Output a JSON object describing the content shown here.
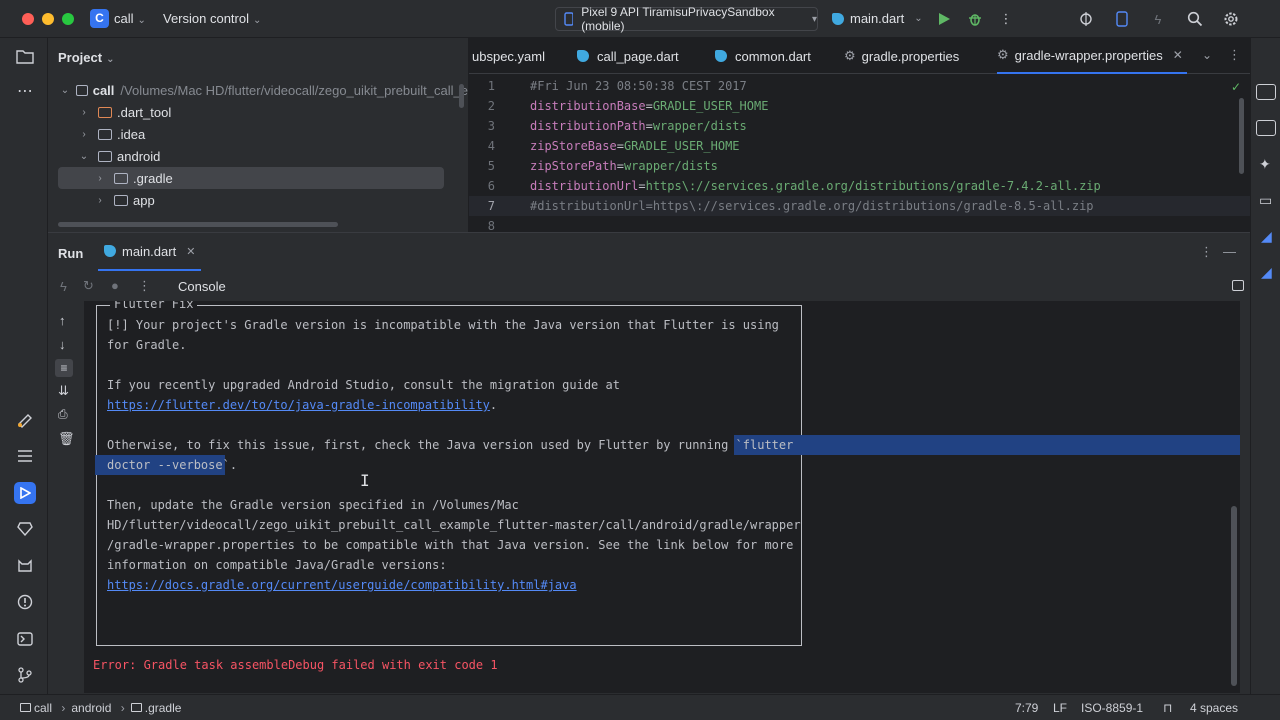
{
  "titlebar": {
    "project_badge": "C",
    "project_name": "call",
    "version_control": "Version control",
    "device": "Pixel 9 API TiramisuPrivacySandbox (mobile)",
    "run_config": "main.dart"
  },
  "project_panel": {
    "title": "Project",
    "tree": [
      {
        "label": "call",
        "path": "/Volumes/Mac HD/flutter/videocall/zego_uikit_prebuilt_call_e"
      },
      {
        "label": ".dart_tool"
      },
      {
        "label": ".idea"
      },
      {
        "label": "android"
      },
      {
        "label": ".gradle"
      },
      {
        "label": "app"
      }
    ]
  },
  "editor": {
    "tabs": [
      "ubspec.yaml",
      "call_page.dart",
      "common.dart",
      "gradle.properties",
      "gradle-wrapper.properties"
    ],
    "line_numbers": [
      "1",
      "2",
      "3",
      "4",
      "5",
      "6",
      "7",
      "8"
    ],
    "lines": [
      {
        "comment": "#Fri Jun 23 08:50:38 CEST 2017"
      },
      {
        "key": "distributionBase",
        "value": "GRADLE_USER_HOME"
      },
      {
        "key": "distributionPath",
        "value": "wrapper/dists"
      },
      {
        "key": "zipStoreBase",
        "value": "GRADLE_USER_HOME"
      },
      {
        "key": "zipStorePath",
        "value": "wrapper/dists"
      },
      {
        "key": "distributionUrl",
        "value": "https\\://services.gradle.org/distributions/gradle-7.4.2-all.zip"
      },
      {
        "comment": "#distributionUrl=https\\://services.gradle.org/distributions/gradle-8.5-all.zip"
      },
      {
        "comment": ""
      }
    ],
    "equals": "="
  },
  "run_panel": {
    "label": "Run",
    "tab": "main.dart",
    "console_label": "Console",
    "box_title": "Flutter Fix",
    "lines": [
      "[!] Your project's Gradle version is incompatible with the Java version that Flutter is using",
      "for Gradle.",
      "If you recently upgraded Android Studio, consult the migration guide at",
      "https://flutter.dev/to/to/java-gradle-incompatibility",
      ".",
      "Otherwise, to fix this issue, first, check the Java version used by Flutter by running `",
      "flutter",
      "doctor --verbose",
      "`.",
      "Then, update the Gradle version specified in /Volumes/Mac",
      "HD/flutter/videocall/zego_uikit_prebuilt_call_example_flutter-master/call/android/gradle/wrapper",
      "/gradle-wrapper.properties to be compatible with that Java version. See the link below for more",
      "information on compatible Java/Gradle versions:",
      "https://docs.gradle.org/current/userguide/compatibility.html#java"
    ],
    "error": "Error: Gradle task assembleDebug failed with exit code 1"
  },
  "statusbar": {
    "breadcrumb": [
      "call",
      "android",
      ".gradle"
    ],
    "position": "7:79",
    "line_sep": "LF",
    "encoding": "ISO-8859-1",
    "indent": "4 spaces"
  }
}
